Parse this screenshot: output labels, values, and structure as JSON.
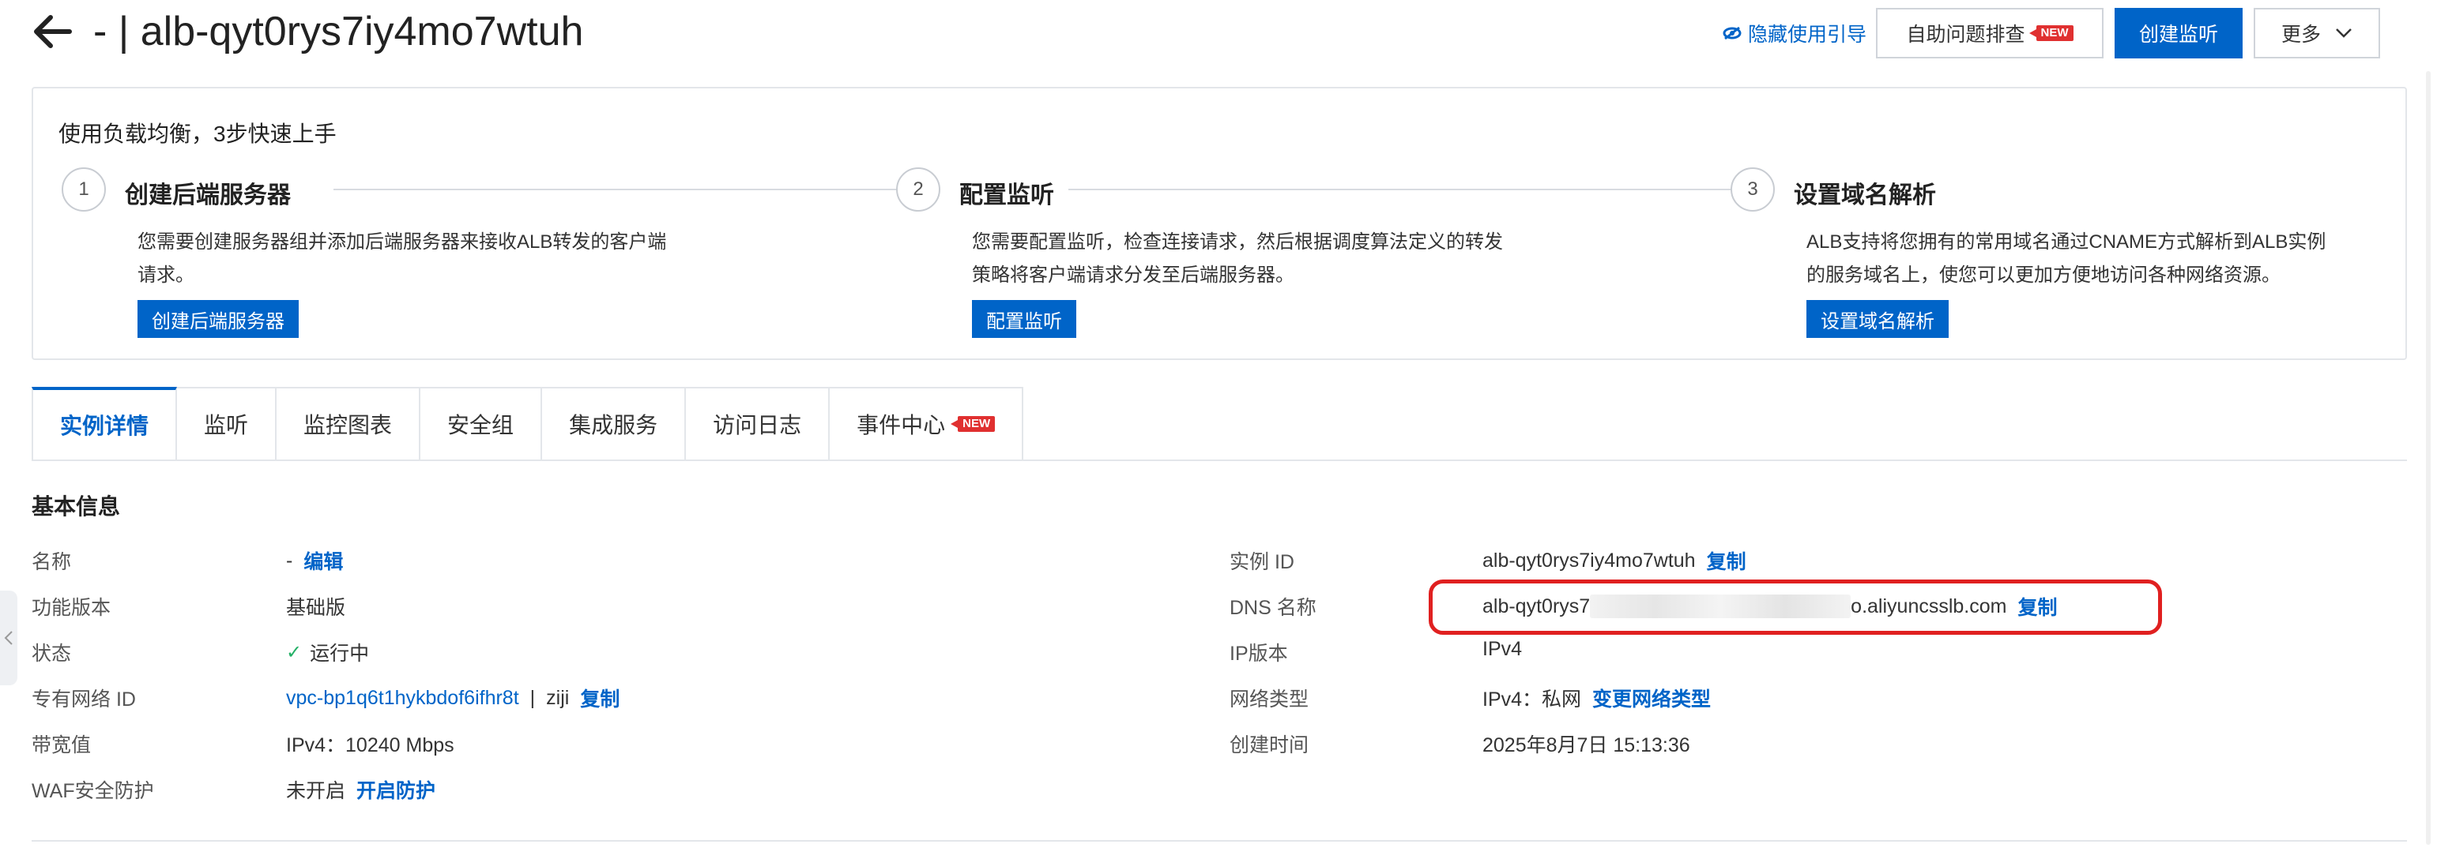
{
  "header": {
    "title": "- | alb-qyt0rys7iy4mo7wtuh",
    "hide_guide": "隐藏使用引导",
    "self_help": "自助问题排查",
    "new_badge": "NEW",
    "create_listener": "创建监听",
    "more": "更多"
  },
  "quickstart": {
    "title": "使用负载均衡，3步快速上手",
    "steps": [
      {
        "num": "1",
        "title": "创建后端服务器",
        "desc": "您需要创建服务器组并添加后端服务器来接收ALB转发的客户端请求。",
        "button": "创建后端服务器"
      },
      {
        "num": "2",
        "title": "配置监听",
        "desc": "您需要配置监听，检查连接请求，然后根据调度算法定义的转发策略将客户端请求分发至后端服务器。",
        "button": "配置监听"
      },
      {
        "num": "3",
        "title": "设置域名解析",
        "desc": "ALB支持将您拥有的常用域名通过CNAME方式解析到ALB实例的服务域名上，使您可以更加方便地访问各种网络资源。",
        "button": "设置域名解析"
      }
    ]
  },
  "tabs": [
    "实例详情",
    "监听",
    "监控图表",
    "安全组",
    "集成服务",
    "访问日志",
    "事件中心"
  ],
  "tab_new_badge": "NEW",
  "basic": {
    "section_title": "基本信息",
    "left": {
      "name_label": "名称",
      "name_value": "-",
      "name_edit": "编辑",
      "version_label": "功能版本",
      "version_value": "基础版",
      "status_label": "状态",
      "status_value": "运行中",
      "vpc_label": "专有网络 ID",
      "vpc_value": "vpc-bp1q6t1hykbdof6ifhr8t",
      "vpc_sep": "|",
      "vpc_name": "ziji",
      "vpc_copy": "复制",
      "bandwidth_label": "带宽值",
      "bandwidth_value": "IPv4：10240 Mbps",
      "waf_label": "WAF安全防护",
      "waf_value": "未开启",
      "waf_action": "开启防护"
    },
    "right": {
      "instance_label": "实例 ID",
      "instance_value": "alb-qyt0rys7iy4mo7wtuh",
      "instance_copy": "复制",
      "dns_label": "DNS 名称",
      "dns_prefix": "alb-qyt0rys7",
      "dns_suffix": "o.aliyuncsslb.com",
      "dns_copy": "复制",
      "ipver_label": "IP版本",
      "ipver_value": "IPv4",
      "nettype_label": "网络类型",
      "nettype_value": "IPv4：私网",
      "nettype_action": "变更网络类型",
      "created_label": "创建时间",
      "created_value": "2025年8月7日 15:13:36"
    }
  }
}
